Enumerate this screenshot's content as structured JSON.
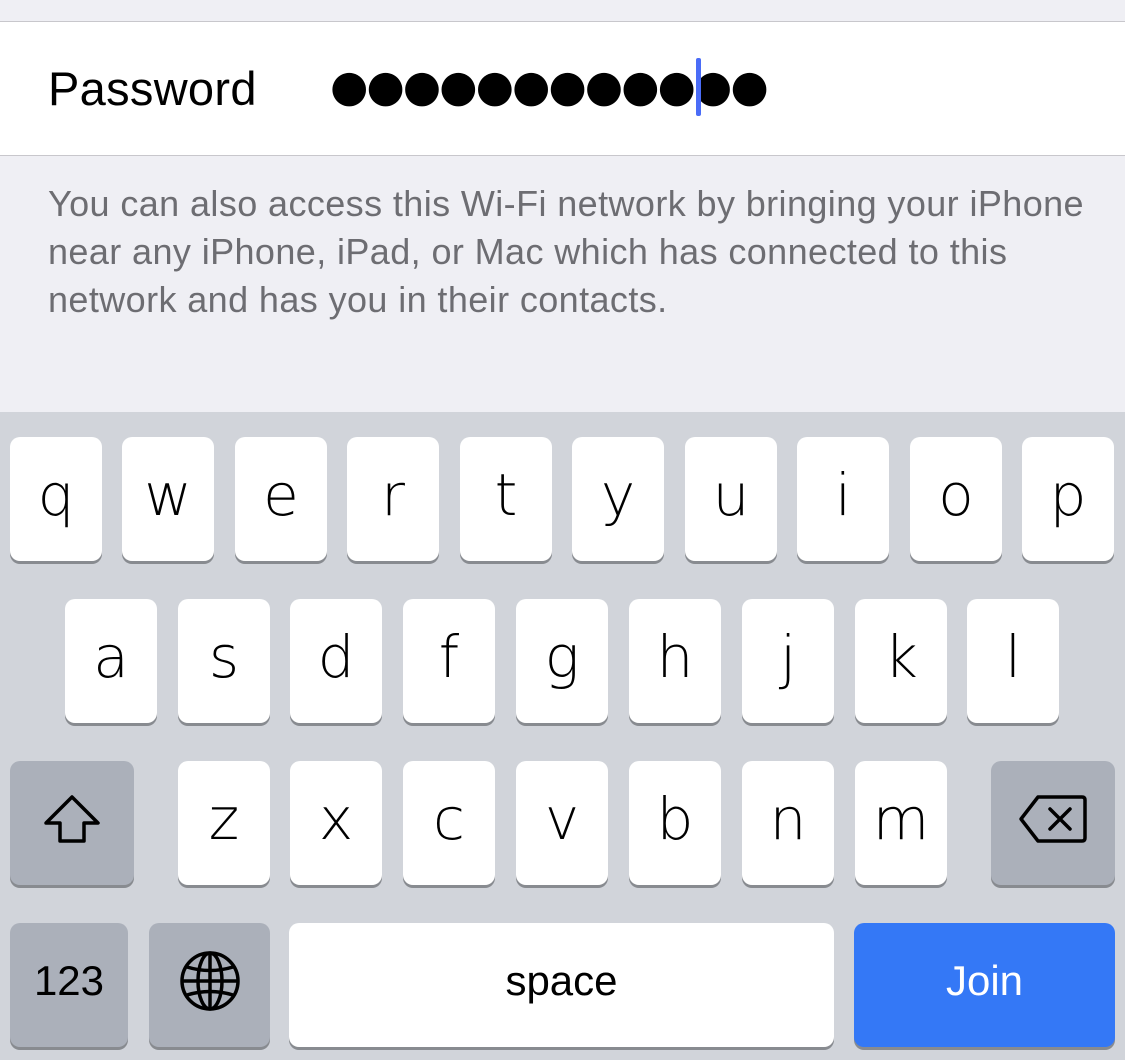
{
  "password_row": {
    "label": "Password",
    "masked_value": "●●●●●●●●●●●●"
  },
  "footer_note": "You can also access this Wi-Fi network by bringing your iPhone near any iPhone, iPad, or Mac which has connected to this network and has you in their contacts.",
  "keyboard": {
    "row1": [
      "q",
      "w",
      "e",
      "r",
      "t",
      "y",
      "u",
      "i",
      "o",
      "p"
    ],
    "row2": [
      "a",
      "s",
      "d",
      "f",
      "g",
      "h",
      "j",
      "k",
      "l"
    ],
    "row3": [
      "z",
      "x",
      "c",
      "v",
      "b",
      "n",
      "m"
    ],
    "shift_icon": "shift-arrow-icon",
    "delete_icon": "backspace-icon",
    "numbers_label": "123",
    "globe_icon": "globe-icon",
    "space_label": "space",
    "join_label": "Join"
  },
  "colors": {
    "accent": "#3478f6",
    "cursor": "#4a6cf7",
    "keyboard_bg": "#d1d4da",
    "key_dark": "#abb0ba",
    "note_text": "#6d6d72"
  }
}
